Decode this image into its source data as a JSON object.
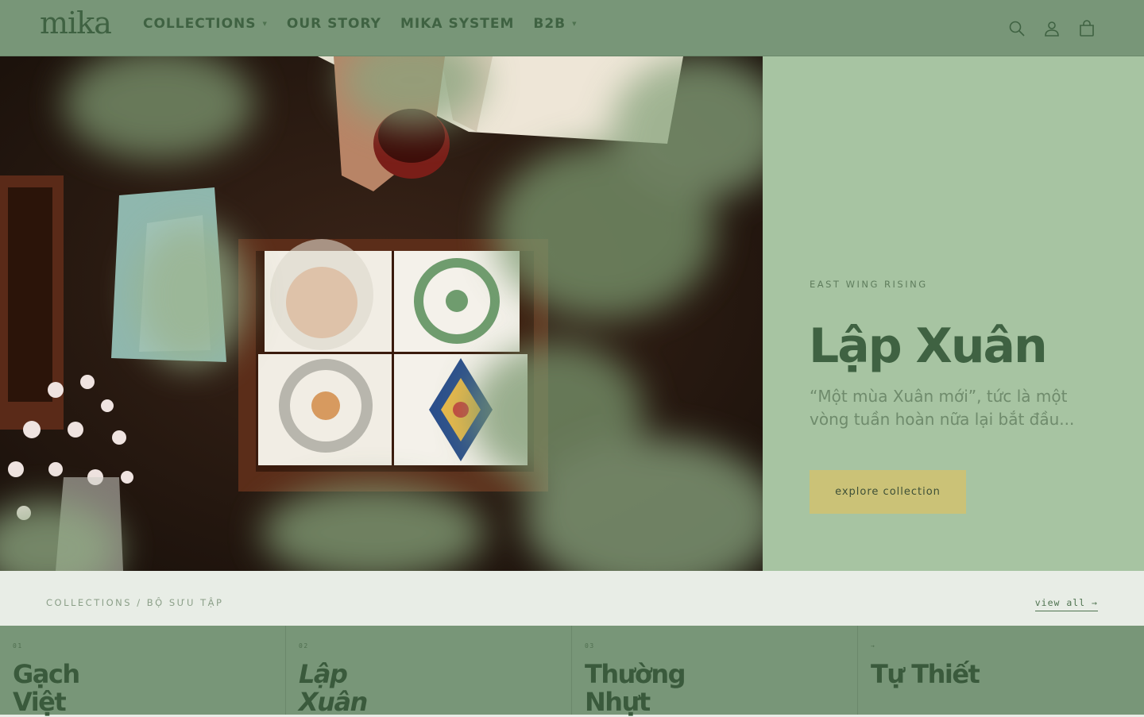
{
  "brand": {
    "logo_text": "mika"
  },
  "nav": {
    "items": [
      {
        "label": "COLLECTIONS",
        "has_dropdown": true
      },
      {
        "label": "OUR STORY",
        "has_dropdown": false
      },
      {
        "label": "MIKA SYSTEM",
        "has_dropdown": false
      },
      {
        "label": "B2B",
        "has_dropdown": true
      }
    ],
    "caret_glyph": "▼"
  },
  "header_icons": [
    "search-icon",
    "account-icon",
    "cart-icon"
  ],
  "hero": {
    "eyebrow": "EAST WING RISING",
    "title": "Lập Xuân",
    "quote": "“Một mùa Xuân mới”, tức là một vòng tuần hoàn nữa lại bắt đầu...",
    "cta_label": "explore collection"
  },
  "collections_strip": {
    "label": "COLLECTIONS / BỘ SƯU TẬP",
    "view_all": "view all →"
  },
  "collection_cards": [
    {
      "num": "01",
      "title": "Gạch Việt",
      "italic": false
    },
    {
      "num": "02",
      "title": "Lập Xuân",
      "italic": true
    },
    {
      "num": "03",
      "title": "Thường Nhựt",
      "italic": false
    },
    {
      "num": "→",
      "title": "Tự Thiết",
      "italic": false
    }
  ],
  "colors": {
    "header_bg": "#789678",
    "text_green": "#3f6242",
    "hero_panel_bg": "#a7c4a2",
    "cta_bg": "#cbc277",
    "strip_bg": "#e8ede6"
  }
}
